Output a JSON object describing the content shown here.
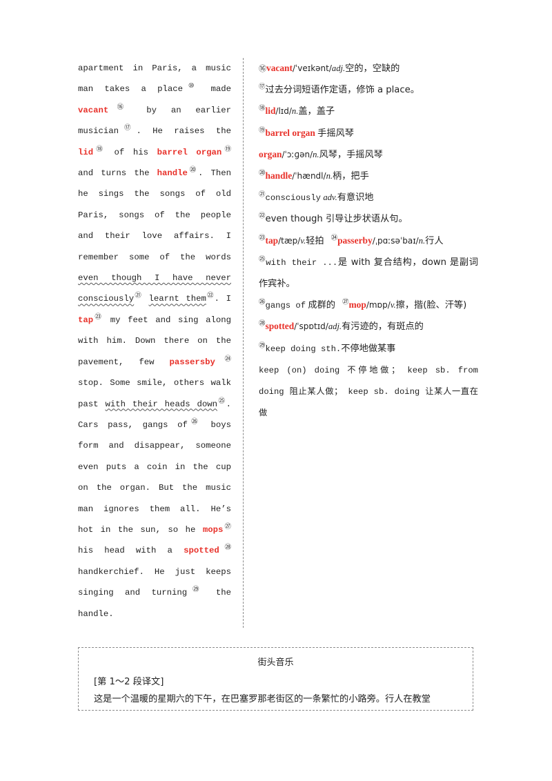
{
  "left_column": {
    "segments": [
      {
        "text": "apartment in Paris, a music man takes a place",
        "style": "plain"
      },
      {
        "text": "⑩",
        "style": "supnum"
      },
      {
        "text": " made ",
        "style": "plain"
      },
      {
        "text": "vacant",
        "style": "keyword"
      },
      {
        "text": "⑯",
        "style": "supnum"
      },
      {
        "text": " by an earlier musician",
        "style": "plain"
      },
      {
        "text": "⑰",
        "style": "supnum"
      },
      {
        "text": ". He raises the ",
        "style": "plain"
      },
      {
        "text": "lid",
        "style": "keyword"
      },
      {
        "text": "⑱",
        "style": "supnum"
      },
      {
        "text": " of his ",
        "style": "plain"
      },
      {
        "text": "barrel organ",
        "style": "keyword"
      },
      {
        "text": "⑲",
        "style": "supnum"
      },
      {
        "text": " and turns the ",
        "style": "plain"
      },
      {
        "text": "handle",
        "style": "keyword"
      },
      {
        "text": "⑳",
        "style": "supnum"
      },
      {
        "text": ". Then he sings the songs of old Paris, songs of the people and their love affairs. I remember some of the words ",
        "style": "plain"
      },
      {
        "text": "even though I have never consciously",
        "style": "wavy"
      },
      {
        "text": "㉑",
        "style": "supnum"
      },
      {
        "text": " ",
        "style": "plain"
      },
      {
        "text": "learnt them",
        "style": "wavy"
      },
      {
        "text": "㉒",
        "style": "supnum"
      },
      {
        "text": ". I ",
        "style": "plain"
      },
      {
        "text": "tap",
        "style": "keyword"
      },
      {
        "text": "㉓",
        "style": "supnum"
      },
      {
        "text": " my feet and sing along with him. Down there on the pavement, few ",
        "style": "plain"
      },
      {
        "text": "passersby",
        "style": "keyword"
      },
      {
        "text": "㉔",
        "style": "supnum"
      },
      {
        "text": " stop. Some smile, others walk past ",
        "style": "plain"
      },
      {
        "text": "with their heads down",
        "style": "wavy"
      },
      {
        "text": "㉕",
        "style": "supnum"
      },
      {
        "text": ". Cars pass, gangs of",
        "style": "plain"
      },
      {
        "text": "㉖",
        "style": "supnum"
      },
      {
        "text": " boys form and disappear, someone even puts a coin in the cup on the organ. But the music man ignores them all. He’s hot in the sun, so he ",
        "style": "plain"
      },
      {
        "text": "mops",
        "style": "keyword"
      },
      {
        "text": "㉗",
        "style": "supnum"
      },
      {
        "text": " his head with a ",
        "style": "plain"
      },
      {
        "text": "spotted",
        "style": "keyword"
      },
      {
        "text": "㉘",
        "style": "supnum"
      },
      {
        "text": " handkerchief. He just keeps singing and turning",
        "style": "plain"
      },
      {
        "text": "㉙",
        "style": "supnum"
      },
      {
        "text": " the handle.",
        "style": "plain"
      }
    ],
    "plain_text": "apartment in Paris, a music man takes a place⑩ made vacant⑯ by an earlier musician⑰. He raises the lid⑱ of his barrel organ⑲ and turns the handle⑳. Then he sings the songs of old Paris, songs of the people and their love affairs. I remember some of the words even though I have never consciously㉑ learnt them㉒. I tap㉓ my feet and sing along with him. Down there on the pavement, few passersby㉔ stop. Some smile, others walk past with their heads down㉕. Cars pass, gangs of㉖ boys form and disappear, someone even puts a coin in the cup on the organ. But the music man ignores them all. He’s hot in the sun, so he mops㉗ his head with a spotted㉘ handkerchief. He just keeps singing and turning㉙ the handle."
  },
  "right_column": {
    "notes": [
      {
        "num": "⑯",
        "num_position": "inline",
        "word": "vacant",
        "phonetic": "/ˈveɪkənt/",
        "pos": "adj.",
        "gloss": "空的，空缺的"
      },
      {
        "num": "⑰",
        "num_position": "super",
        "word": "",
        "phonetic": "",
        "pos": "",
        "gloss": "过去分词短语作定语，修饰 a place。"
      },
      {
        "num": "⑱",
        "num_position": "super",
        "word": "lid",
        "phonetic": "/lɪd/",
        "pos": "n.",
        "gloss": "盖，盖子"
      },
      {
        "num": "⑲",
        "num_position": "super",
        "word": "barrel organ",
        "phonetic": "",
        "pos": "",
        "gloss": "手摇风琴"
      },
      {
        "num": "",
        "num_position": "none",
        "word": "organ",
        "phonetic": "/ˈɔːɡən/",
        "pos": "n.",
        "gloss": "风琴，手摇风琴"
      },
      {
        "num": "⑳",
        "num_position": "super",
        "word": "handle",
        "phonetic": "/ˈhændl/",
        "pos": "n.",
        "gloss": "柄，把手"
      },
      {
        "num": "㉑",
        "num_position": "super",
        "word": "consciously",
        "phonetic": "",
        "pos": "adv.",
        "gloss": "有意识地"
      },
      {
        "num": "㉒",
        "num_position": "super",
        "word": "",
        "phonetic": "",
        "pos": "",
        "gloss": "even though 引导让步状语从句。"
      },
      {
        "num": "㉓",
        "num_position": "super",
        "word": "tap",
        "phonetic": "/tæp/",
        "pos": "v.",
        "gloss": "轻拍"
      },
      {
        "num": "㉔",
        "num_position": "super",
        "word": "passerby",
        "phonetic": "/ˌpɑːsəˈbaɪ/",
        "pos": "n.",
        "gloss": "行人"
      },
      {
        "num": "㉕",
        "num_position": "super",
        "word": "",
        "phonetic": "",
        "pos": "",
        "gloss": "with their ...是 with 复合结构，down 是副词作宾补。"
      },
      {
        "num": "㉖",
        "num_position": "super",
        "word": "gangs of",
        "phonetic": "",
        "pos": "",
        "gloss": "成群的"
      },
      {
        "num": "㉗",
        "num_position": "super",
        "word": "mop",
        "phonetic": "/mɒp/",
        "pos": "v.",
        "gloss": "擦，揩(脸、汗等)"
      },
      {
        "num": "㉘",
        "num_position": "super",
        "word": "spotted",
        "phonetic": "/ˈspɒtɪd/",
        "pos": "adj.",
        "gloss": "有污迹的，有斑点的"
      },
      {
        "num": "㉙",
        "num_position": "super",
        "word": "",
        "phonetic": "",
        "pos": "",
        "gloss": "keep doing sth. 不停地做某事"
      },
      {
        "num": "",
        "num_position": "none",
        "word": "",
        "phonetic": "",
        "pos": "",
        "gloss": "keep (on) doing 不停地做； keep sb. from doing 阻止某人做； keep sb. doing 让某人一直在做"
      }
    ],
    "line_20": {
      "num": "⑯",
      "word": "vacant",
      "phonetic": "/ˈveɪkənt/",
      "pos": "adj.",
      "gloss": "空的，空缺的"
    },
    "line_21": {
      "num": "⑰",
      "gloss": "过去分词短语作定语，修饰 a place。"
    },
    "line_22": {
      "num": "⑱",
      "word": "lid",
      "phonetic": "/lɪd/",
      "pos": "n.",
      "gloss": "盖，盖子"
    },
    "line_23": {
      "num": "⑲",
      "word": "barrel organ",
      "gloss": "手摇风琴"
    },
    "line_organ": {
      "word": "organ",
      "phonetic": "/ˈɔːɡən/",
      "pos": "n.",
      "gloss": "风琴，手摇风琴"
    },
    "line_24": {
      "num": "⑳",
      "word": "handle",
      "phonetic": "/ˈhændl/",
      "pos": "n.",
      "gloss": "柄，把手"
    },
    "line_25": {
      "num": "㉑",
      "word": "consciously",
      "pos": "adv.",
      "gloss": "有意识地"
    },
    "line_26": {
      "num": "㉒",
      "gloss": "even though 引导让步状语从句。"
    },
    "line_27": {
      "num": "㉓",
      "word": "tap",
      "phonetic": "/tæp/",
      "pos": "v.",
      "gloss": "轻拍"
    },
    "line_28": {
      "num": "㉔",
      "word": "passerby",
      "phonetic": "/ˌpɑːsəˈbaɪ/",
      "pos": "n.",
      "gloss": "行人"
    },
    "line_29": {
      "num": "㉕",
      "gloss_en": "with their ...",
      "gloss": "是 with 复合结构，down 是副词作宾补。"
    },
    "line_30": {
      "num": "㉖",
      "word": "gangs of",
      "gloss": "成群的"
    },
    "line_31": {
      "num": "㉗",
      "word": "mop",
      "phonetic": "/mɒp/",
      "pos": "v.",
      "gloss": "擦，揩(脸、汗等)"
    },
    "line_32": {
      "num": "㉘",
      "word": "spotted",
      "phonetic": "/ˈspɒtɪd/",
      "pos": "adj.",
      "gloss": "有污迹的，有斑点的"
    },
    "line_33": {
      "num": "㉙",
      "gloss_en": "keep doing sth.",
      "gloss": "不停地做某事"
    },
    "line_34": {
      "gloss": "keep (on) doing 不停地做； keep sb. from doing 阻止某人做； keep sb. doing 让某人一直在做"
    }
  },
  "translation_box": {
    "title": "街头音乐",
    "label": "[第 1～2 段译文]",
    "body": "这是一个温暖的星期六的下午，在巴塞罗那老街区的一条繁忙的小路旁。行人在教堂"
  },
  "colors": {
    "keyword_red": "#e8312a",
    "text": "#222222",
    "divider": "#8a8a8a",
    "page_background": "#ffffff"
  }
}
